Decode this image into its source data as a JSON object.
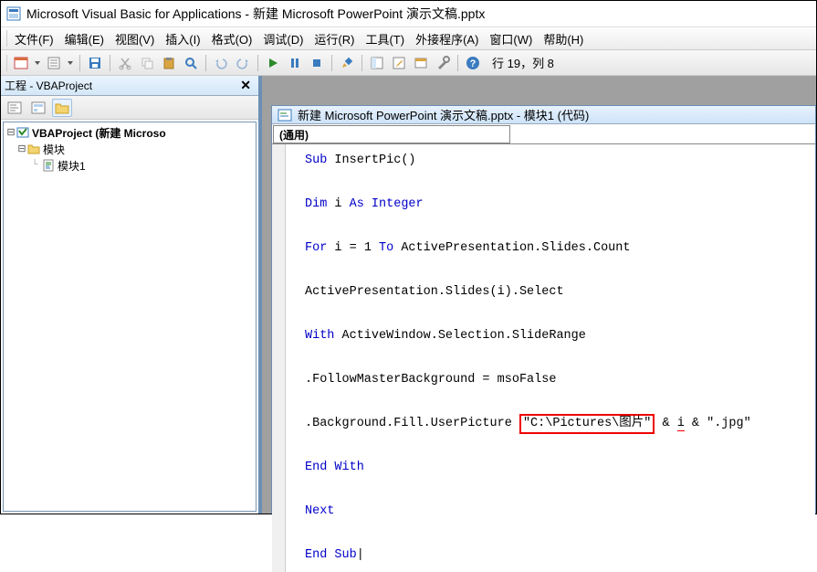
{
  "title": "Microsoft Visual Basic for Applications - 新建 Microsoft PowerPoint 演示文稿.pptx",
  "menu": {
    "file": "文件(F)",
    "edit": "编辑(E)",
    "view": "视图(V)",
    "insert": "插入(I)",
    "format": "格式(O)",
    "debug": "调试(D)",
    "run": "运行(R)",
    "tools": "工具(T)",
    "addins": "外接程序(A)",
    "window": "窗口(W)",
    "help": "帮助(H)"
  },
  "status": "行 19，列 8",
  "project_panel": {
    "title": "工程 - VBAProject"
  },
  "tree": {
    "root": "VBAProject (新建 Microso",
    "modules": "模块",
    "module1": "模块1"
  },
  "code_window_title": "新建 Microsoft PowerPoint 演示文稿.pptx - 模块1 (代码)",
  "dropdown": {
    "general": "(通用)"
  },
  "code": {
    "l1a": "Sub",
    "l1b": " InsertPic()",
    "l2a": "Dim",
    "l2b": " i ",
    "l2c": "As Integer",
    "l3a": "For",
    "l3b": " i = 1 ",
    "l3c": "To",
    "l3d": " ActivePresentation.Slides.Count",
    "l4": "ActivePresentation.Slides(i).Select",
    "l5a": "With",
    "l5b": " ActiveWindow.Selection.SlideRange",
    "l6": ".FollowMasterBackground = msoFalse",
    "l7a": ".Background.Fill.UserPicture ",
    "l7b": "\"C:\\Pictures\\图片\"",
    "l7c": " & ",
    "l7d": "i",
    "l7e": " & \".jpg\"",
    "l8": "End With",
    "l9": "Next",
    "l10": "End Sub"
  }
}
